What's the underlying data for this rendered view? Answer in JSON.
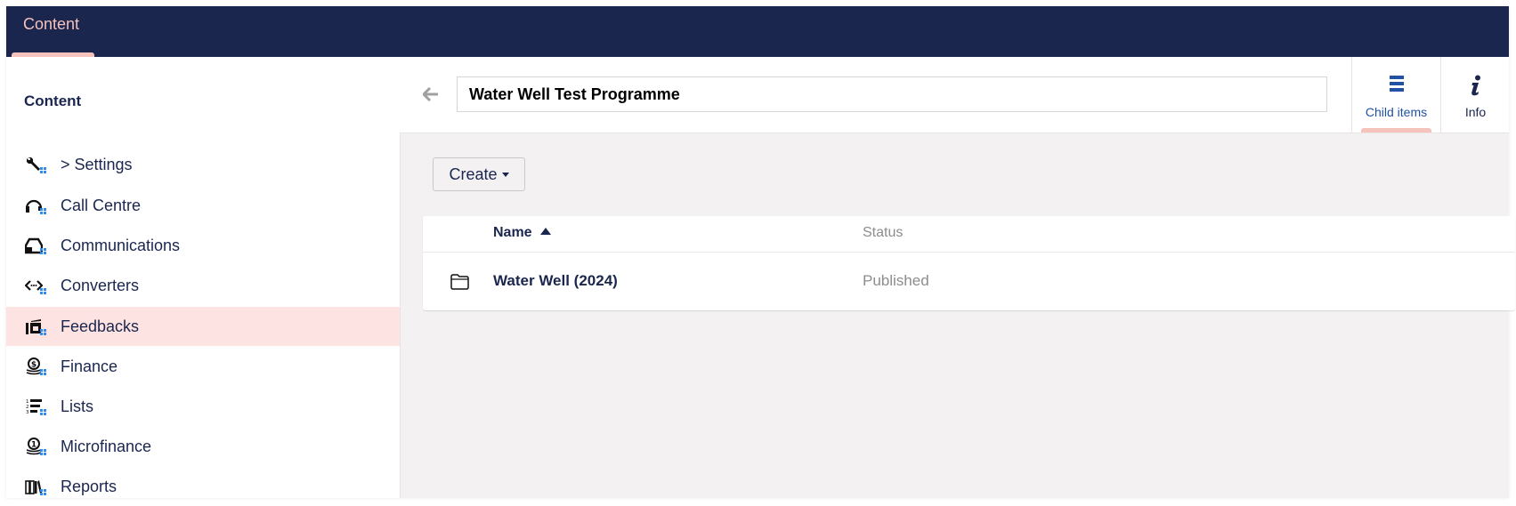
{
  "topbar": {
    "section_tab": "Content"
  },
  "sidebar": {
    "heading": "Content",
    "items": [
      {
        "label": "> Settings",
        "icon": "wrench-icon"
      },
      {
        "label": "Call Centre",
        "icon": "headset-icon"
      },
      {
        "label": "Communications",
        "icon": "inbox-icon"
      },
      {
        "label": "Converters",
        "icon": "code-arrows-icon"
      },
      {
        "label": "Feedbacks",
        "icon": "feedback-icon",
        "active": true
      },
      {
        "label": "Finance",
        "icon": "coins-dollar-icon"
      },
      {
        "label": "Lists",
        "icon": "numbered-list-icon"
      },
      {
        "label": "Microfinance",
        "icon": "coins-one-icon"
      },
      {
        "label": "Reports",
        "icon": "books-icon"
      }
    ]
  },
  "header": {
    "name_value": "Water Well Test Programme",
    "tabs": [
      {
        "label": "Child items",
        "icon": "list-icon",
        "active": true
      },
      {
        "label": "Info",
        "icon": "info-icon"
      }
    ]
  },
  "toolbar": {
    "create_label": "Create"
  },
  "table": {
    "columns": [
      {
        "label": "Name",
        "sort": "ascending"
      },
      {
        "label": "Status"
      }
    ],
    "rows": [
      {
        "icon": "folder-icon",
        "name": "Water Well (2024)",
        "status": "Published"
      }
    ]
  },
  "colors": {
    "topbar_bg": "#1b264f",
    "accent_pink": "#f5c2bc",
    "active_item_bg": "#fde3e1",
    "link_blue": "#2152a3",
    "workspace_bg": "#f3f1f1"
  }
}
